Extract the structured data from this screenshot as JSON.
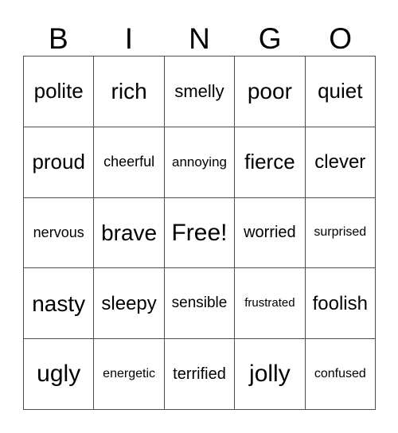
{
  "card": {
    "title_letters": [
      "B",
      "I",
      "N",
      "G",
      "O"
    ],
    "columns": 5,
    "rows": 5,
    "border_color": "#4d4d4d",
    "text_color": "#000000",
    "background_color": "#ffffff",
    "free_space_label": "Free!",
    "free_space_position": {
      "row": 3,
      "column": 3
    },
    "rows_data": [
      [
        {
          "label": "polite",
          "size": 26
        },
        {
          "label": "rich",
          "size": 28
        },
        {
          "label": "smelly",
          "size": 22
        },
        {
          "label": "poor",
          "size": 28
        },
        {
          "label": "quiet",
          "size": 26
        }
      ],
      [
        {
          "label": "proud",
          "size": 26
        },
        {
          "label": "cheerful",
          "size": 18
        },
        {
          "label": "annoying",
          "size": 17
        },
        {
          "label": "fierce",
          "size": 26
        },
        {
          "label": "clever",
          "size": 24
        }
      ],
      [
        {
          "label": "nervous",
          "size": 18
        },
        {
          "label": "brave",
          "size": 28
        },
        {
          "label": "Free!",
          "size": 30
        },
        {
          "label": "worried",
          "size": 20
        },
        {
          "label": "surprised",
          "size": 16
        }
      ],
      [
        {
          "label": "nasty",
          "size": 28
        },
        {
          "label": "sleepy",
          "size": 24
        },
        {
          "label": "sensible",
          "size": 19
        },
        {
          "label": "frustrated",
          "size": 15
        },
        {
          "label": "foolish",
          "size": 24
        }
      ],
      [
        {
          "label": "ugly",
          "size": 30
        },
        {
          "label": "energetic",
          "size": 16
        },
        {
          "label": "terrified",
          "size": 20
        },
        {
          "label": "jolly",
          "size": 30
        },
        {
          "label": "confused",
          "size": 16
        }
      ]
    ]
  }
}
